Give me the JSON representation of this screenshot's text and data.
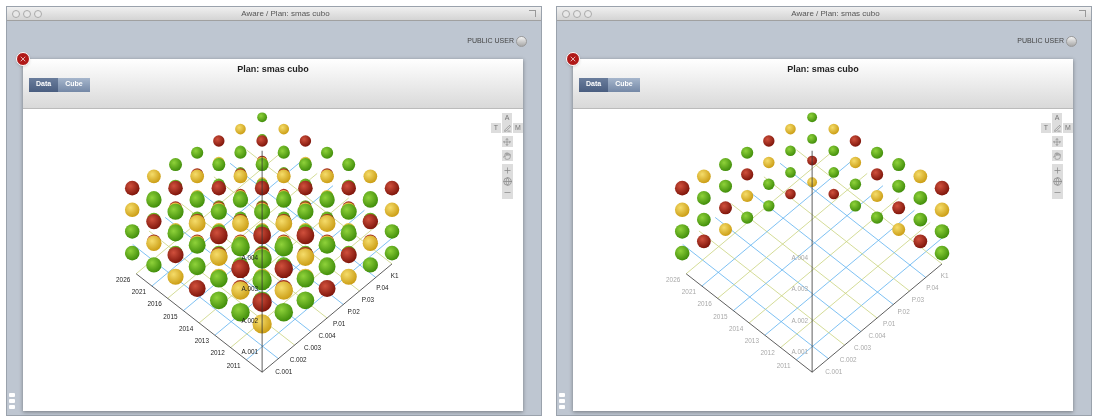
{
  "windows": [
    {
      "kind": "full",
      "title": "Aware / Plan: smas cubo",
      "user": "PUBLIC USER",
      "panel_title": "Plan: smas cubo",
      "tabs": [
        {
          "label": "Data",
          "selected": false
        },
        {
          "label": "Cube",
          "selected": true
        }
      ],
      "toolbar_keys": [
        "A",
        "T",
        "M"
      ],
      "chart": {
        "labels_dimmed": false,
        "left_labels": [
          "2026",
          "2021",
          "2016",
          "2015",
          "2014",
          "2013",
          "2012",
          "2011"
        ],
        "vertical_labels": [
          "A.004",
          "A.003",
          "A.002",
          "A.001"
        ],
        "right_labels": [
          "C.001",
          "C.002",
          "C.003",
          "C.004",
          "P.01",
          "P.02",
          "P.03",
          "P.04",
          "K1"
        ]
      }
    },
    {
      "kind": "walls",
      "title": "Aware / Plan: smas cubo",
      "user": "PUBLIC USER",
      "panel_title": "Plan: smas cubo",
      "tabs": [
        {
          "label": "Data",
          "selected": false
        },
        {
          "label": "Cube",
          "selected": true
        }
      ],
      "toolbar_keys": [
        "A",
        "T",
        "M"
      ],
      "chart": {
        "labels_dimmed": true,
        "left_labels": [
          "2026",
          "2021",
          "2016",
          "2015",
          "2014",
          "2013",
          "2012",
          "2011"
        ],
        "vertical_labels": [
          "A.004",
          "A.003",
          "A.002",
          "A.001"
        ],
        "right_labels": [
          "C.001",
          "C.002",
          "C.003",
          "C.004",
          "P.01",
          "P.02",
          "P.03",
          "P.04",
          "K1"
        ]
      }
    }
  ]
}
